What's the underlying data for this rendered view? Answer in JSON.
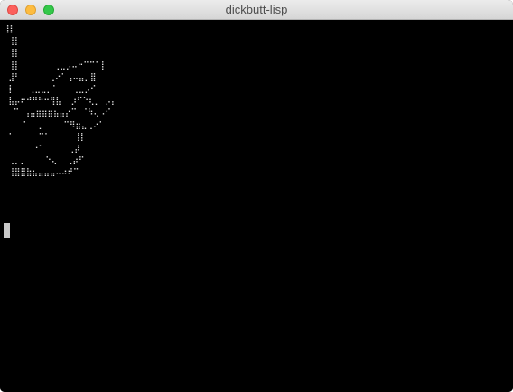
{
  "window": {
    "title": "dickbutt-lisp"
  },
  "terminal": {
    "output": "⢸⡇\n ⢸⡇\n ⢸⡇\n ⢸⡇       ⢀⣀⡠⠤⠒⠉⠉⠁⡇\n ⣸⠃      ⢀⠔⠁⢠⠤⣤⡀⣿\n ⡇   ⢀⣀⣀⡀⠁   ⢀⣀⡠⠊\n ⣧⡤⠖⠚⠛⠓⠒⢻⣧  ⡰⠋⠑⢆⡀ ⡠⡄\n  ⠉ ⢠⣤⣶⣶⣶⣦⣤⡔⠉ ⠈⠳⢄⠠⠊\n    ⠁  ⡀    ⠉⠻⣶⣄⢀⠔⠁\n ⠁     ⠉⠁     ⢸⡇\n      ⠐⠁     ⢀⡼\n ⢀⡀⡀    ⠑⢄  ⢀⡴⠋\n ⢸⣿⣿⣷⣦⣤⣤⣤⠤⠴⠞⠉"
  },
  "colors": {
    "background": "#000000",
    "foreground": "#e6e6e6",
    "cursor": "#c9c9c9",
    "titlebar": "#e4e4e4",
    "close": "#fc605c",
    "minimize": "#fdbc40",
    "zoom": "#34c84a"
  }
}
